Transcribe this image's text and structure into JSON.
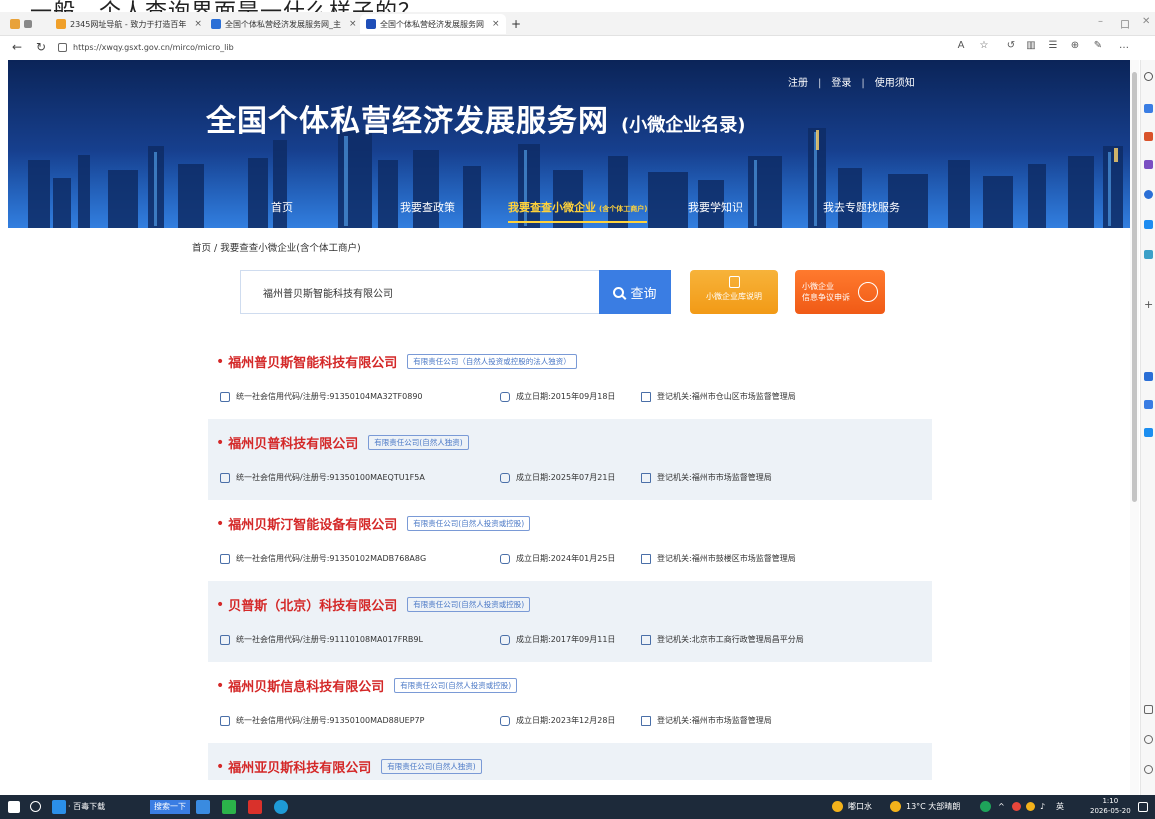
{
  "top_text": "一般，个人查询界面是一什么样子的？",
  "browser": {
    "tabs": [
      {
        "label": "2345网址导航 - 致力于打造百年",
        "active": false,
        "color": "#f0a02a"
      },
      {
        "label": "全国个体私营经济发展服务网_主",
        "active": false,
        "color": "#2b6fd6"
      },
      {
        "label": "全国个体私营经济发展服务网",
        "active": true,
        "color": "#1f4fb8"
      }
    ],
    "url": "https://xwqy.gsxt.gov.cn/mirco/micro_lib",
    "window_controls": [
      "–",
      "口",
      "✕"
    ]
  },
  "site": {
    "title": "全国个体私营经济发展服务网",
    "subtitle": "(小微企业名录)",
    "top_links": [
      "注册",
      "登录",
      "使用须知"
    ],
    "nav": [
      {
        "label": "首页",
        "small": ""
      },
      {
        "label": "我要查政策",
        "small": ""
      },
      {
        "label": "我要查查小微企业",
        "small": "(含个体工商户)"
      },
      {
        "label": "我要学知识",
        "small": ""
      },
      {
        "label": "我去专题找服务",
        "small": ""
      }
    ]
  },
  "breadcrumb": "首页 / 我要查查小微企业(含个体工商户)",
  "search": {
    "value": "福州普贝斯智能科技有限公司",
    "button_label": "查询",
    "lib_button": "小微企业库说明",
    "dispute_button_line1": "小微企业",
    "dispute_button_line2": "信息争议申诉"
  },
  "labels": {
    "credit": "统一社会信用代码/注册号: ",
    "date": "成立日期: ",
    "authority": "登记机关: "
  },
  "results": [
    {
      "name": "福州普贝斯智能科技有限公司",
      "type": "有限责任公司（自然人投资或控股的法人独资）",
      "credit_code": "91350104MA32TF0890",
      "founded": "2015年09月18日",
      "authority": "福州市仓山区市场监督管理局"
    },
    {
      "name": "福州贝普科技有限公司",
      "type": "有限责任公司(自然人独资)",
      "credit_code": "91350100MAEQTU1F5A",
      "founded": "2025年07月21日",
      "authority": "福州市市场监督管理局"
    },
    {
      "name": "福州贝斯汀智能设备有限公司",
      "type": "有限责任公司(自然人投资或控股)",
      "credit_code": "91350102MADB768A8G",
      "founded": "2024年01月25日",
      "authority": "福州市鼓楼区市场监督管理局"
    },
    {
      "name": "贝普斯（北京）科技有限公司",
      "type": "有限责任公司(自然人投资或控股)",
      "credit_code": "91110108MA017FRB9L",
      "founded": "2017年09月11日",
      "authority": "北京市工商行政管理局昌平分局"
    },
    {
      "name": "福州贝斯信息科技有限公司",
      "type": "有限责任公司(自然人投资或控股)",
      "credit_code": "91350100MAD88UEP7P",
      "founded": "2023年12月28日",
      "authority": "福州市市场监督管理局"
    },
    {
      "name": "福州亚贝斯科技有限公司",
      "type": "有限责任公司(自然人独资)",
      "credit_code": "",
      "founded": "",
      "authority": ""
    }
  ],
  "taskbar": {
    "search_label": "搜索一下",
    "download_label": "· 百毒下载",
    "weather": "13°C 大部晴朗",
    "location": "嘟口水",
    "ime": "英",
    "time": "1:10",
    "date": "2026-05-20"
  },
  "colors": {
    "accent_blue": "#3a7de3",
    "result_red": "#d42828",
    "nav_active": "#ffd23a",
    "lib_orange": "#f29a16",
    "dispute_orange": "#f05a16"
  }
}
